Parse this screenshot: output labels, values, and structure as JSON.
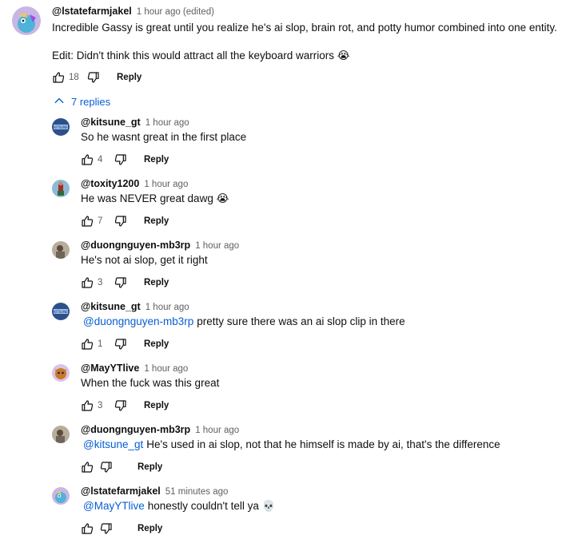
{
  "top_comment": {
    "author": "@lstatefarmjakel",
    "time": "1 hour ago (edited)",
    "text_line1": "Incredible Gassy is great until you realize he's ai slop, brain rot, and potty humor combined into one entity.",
    "text_line2": "Edit: Didn't think this would attract all the keyboard warriors 😭",
    "likes": "18",
    "reply_label": "Reply"
  },
  "replies_toggle": {
    "label": "7 replies"
  },
  "replies": [
    {
      "author": "@kitsune_gt",
      "time": "1 hour ago",
      "mention": "",
      "text": "So he wasnt great in the first place",
      "likes": "4",
      "reply_label": "Reply"
    },
    {
      "author": "@toxity1200",
      "time": "1 hour ago",
      "mention": "",
      "text": "He was NEVER great dawg 😭",
      "likes": "7",
      "reply_label": "Reply"
    },
    {
      "author": "@duongnguyen-mb3rp",
      "time": "1 hour ago",
      "mention": "",
      "text": "He's not ai slop, get it right",
      "likes": "3",
      "reply_label": "Reply"
    },
    {
      "author": "@kitsune_gt",
      "time": "1 hour ago",
      "mention": "@duongnguyen-mb3rp",
      "text": "pretty sure there was an ai slop clip in there",
      "likes": "1",
      "reply_label": "Reply"
    },
    {
      "author": "@MayYTlive",
      "time": "1 hour ago",
      "mention": "",
      "text": "When the fuck was this great",
      "likes": "3",
      "reply_label": "Reply"
    },
    {
      "author": "@duongnguyen-mb3rp",
      "time": "1 hour ago",
      "mention": "@kitsune_gt",
      "text": "He's used in ai slop, not that he himself is made by ai, that's the difference",
      "likes": "",
      "reply_label": "Reply"
    },
    {
      "author": "@lstatefarmjakel",
      "time": "51 minutes ago",
      "mention": "@MayYTlive",
      "text": "honestly couldn't tell ya 💀",
      "likes": "",
      "reply_label": "Reply"
    }
  ],
  "colors": {
    "link": "#065fd4",
    "text": "#0f0f0f",
    "secondary": "#606060"
  }
}
